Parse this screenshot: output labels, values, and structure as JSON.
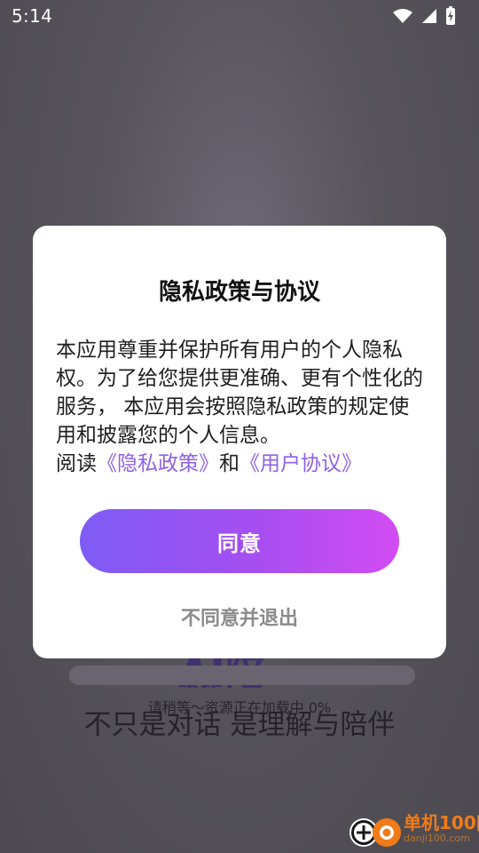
{
  "status_bar": {
    "time": "5:14",
    "icons": [
      "wifi-icon",
      "cellular-signal-icon",
      "battery-charging-icon"
    ]
  },
  "background": {
    "logo_fragment": "AI陪伴",
    "loading_text": "请稍等～资源正在加载中 0%",
    "loading_progress": 0,
    "tagline": "不只是对话 是理解与陪伴"
  },
  "privacy_dialog": {
    "title": "隐私政策与协议",
    "body": "本应用尊重并保护所有用户的个人隐私权。为了给您提供更准确、更有个性化的服务， 本应用会按照隐私政策的规定使用和披露您的个人信息。",
    "read_prefix": "阅读",
    "privacy_policy_link": "《隐私政策》",
    "and_text": "和",
    "user_agreement_link": "《用户协议》",
    "agree_label": "同意",
    "disagree_exit_label": "不同意并退出"
  },
  "watermark": {
    "title": "单机100网",
    "url": "danji100.com",
    "icons": [
      "danji-logo-icon"
    ]
  },
  "colors": {
    "accent_start": "#7e5cf5",
    "accent_end": "#d24cf2",
    "link": "#8f61e8",
    "overlay": "#4f4d52"
  }
}
